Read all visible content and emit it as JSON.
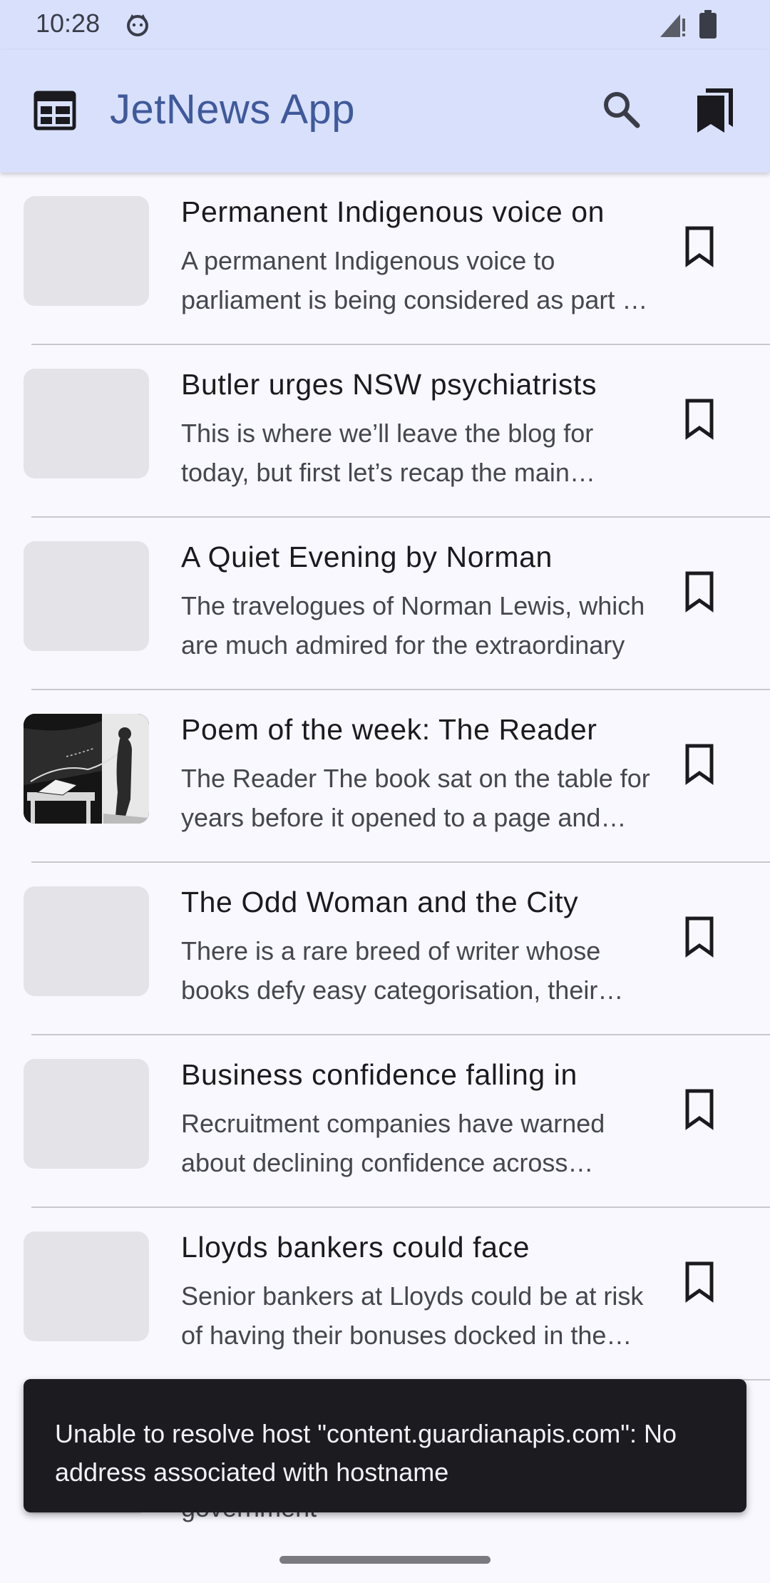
{
  "status_bar": {
    "time": "10:28"
  },
  "app_bar": {
    "title": "JetNews App"
  },
  "articles": [
    {
      "title": "Permanent Indigenous voice on",
      "summary": "A permanent Indigenous voice to parliament is being considered as part of the constitutional recognition debate",
      "image": "placeholder"
    },
    {
      "title": "Butler urges NSW psychiatrists",
      "summary": "This is where we’ll leave the blog for today, but first let’s recap the main events",
      "image": "placeholder"
    },
    {
      "title": "A Quiet Evening by Norman",
      "summary": "The travelogues of Norman Lewis, which are much admired for the extraordinary",
      "image": "placeholder"
    },
    {
      "title": "Poem of the week: The Reader",
      "summary": "The Reader The book sat on the table for years before it opened to a page and spoke",
      "image": "illustration"
    },
    {
      "title": "The Odd Woman and the City",
      "summary": "There is a rare breed of writer whose books defy easy categorisation, their work",
      "image": "placeholder"
    },
    {
      "title": "Business confidence falling in",
      "summary": "Recruitment companies have warned about declining confidence across Europe",
      "image": "placeholder"
    },
    {
      "title": "Lloyds bankers could face",
      "summary": "Senior bankers at Lloyds could be at risk of having their bonuses docked in the latest",
      "image": "placeholder"
    },
    {
      "title": "",
      "summary": "and rein in hiring in response to government",
      "image": "placeholder"
    }
  ],
  "snackbar": {
    "message": "Unable to resolve host \"content.guardianapis.com\": No address associated with hostname"
  },
  "colors": {
    "app_bar_bg": "#d9e0fc",
    "title_color": "#3f5a9b",
    "snackbar_bg": "#1c1b20"
  },
  "icons": {
    "nav": "newspaper-icon",
    "search": "search-icon",
    "bookmarks": "bookmarks-icon",
    "row_action": "bookmark-outline-icon"
  }
}
